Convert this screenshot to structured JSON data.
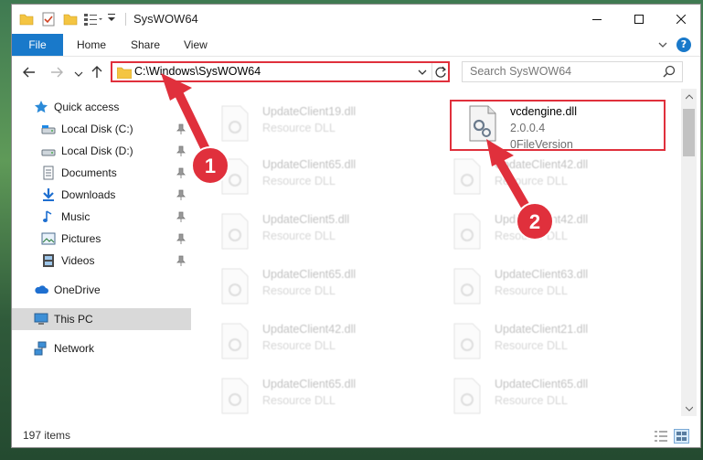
{
  "window": {
    "title": "SysWOW64"
  },
  "ribbon": {
    "tabs": [
      {
        "label": "File"
      },
      {
        "label": "Home"
      },
      {
        "label": "Share"
      },
      {
        "label": "View"
      }
    ],
    "help_label": "?"
  },
  "navigation": {
    "address": "C:\\Windows\\SysWOW64",
    "search_placeholder": "Search SysWOW64"
  },
  "sidebar": {
    "items": [
      {
        "label": "Quick access",
        "icon": "star-icon"
      },
      {
        "label": "Local Disk (C:)",
        "icon": "drive-icon"
      },
      {
        "label": "Local Disk (D:)",
        "icon": "drive-icon"
      },
      {
        "label": "Documents",
        "icon": "documents-icon"
      },
      {
        "label": "Downloads",
        "icon": "download-icon"
      },
      {
        "label": "Music",
        "icon": "music-icon"
      },
      {
        "label": "Pictures",
        "icon": "pictures-icon"
      },
      {
        "label": "Videos",
        "icon": "videos-icon"
      },
      {
        "label": "OneDrive",
        "icon": "cloud-icon"
      },
      {
        "label": "This PC",
        "icon": "computer-icon"
      },
      {
        "label": "Network",
        "icon": "network-icon"
      }
    ]
  },
  "files": [
    {
      "name": "UpdateClient19.dll",
      "type": "Resource DLL"
    },
    {
      "name": "vcdengine.dll",
      "version": "2.0.0.4",
      "type": "0FileVersion"
    },
    {
      "name": "UpdateClient65.dll",
      "type": "Resource DLL"
    },
    {
      "name": "UpdateClient42.dll",
      "type": "Resource DLL"
    },
    {
      "name": "UpdateClient5.dll",
      "type": "Resource DLL"
    },
    {
      "name": "UpdateClient42.dll",
      "type": "Resource DLL"
    },
    {
      "name": "UpdateClient65.dll",
      "type": "Resource DLL"
    },
    {
      "name": "UpdateClient63.dll",
      "type": "Resource DLL"
    },
    {
      "name": "UpdateClient42.dll",
      "type": "Resource DLL"
    },
    {
      "name": "UpdateClient21.dll",
      "type": "Resource DLL"
    },
    {
      "name": "UpdateClient65.dll",
      "type": "Resource DLL"
    },
    {
      "name": "UpdateClient65.dll",
      "type": "Resource DLL"
    }
  ],
  "status": {
    "item_count": "197 items"
  },
  "annotations": {
    "step1": "1",
    "step2": "2",
    "color": "#e0303c"
  },
  "colors": {
    "accent": "#1979ca",
    "highlight": "#e0303c",
    "selected_bg": "#d9d9d9"
  }
}
